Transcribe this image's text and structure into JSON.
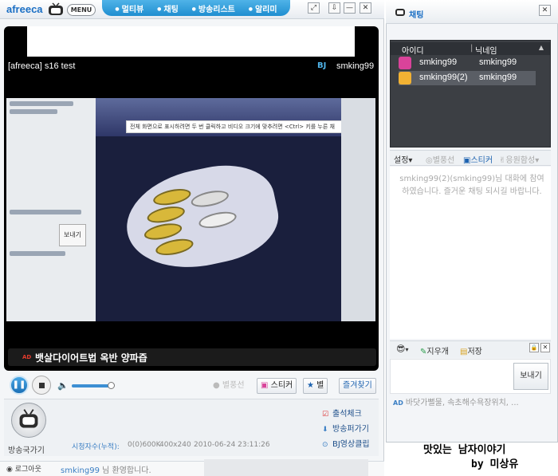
{
  "player": {
    "logo": "afreeca",
    "menu_label": "MENU",
    "tabs": [
      {
        "label": "멀티뷰"
      },
      {
        "label": "채팅"
      },
      {
        "label": "방송리스트"
      },
      {
        "label": "알리미"
      }
    ],
    "window_buttons": [
      "⤢",
      "⇩",
      "—",
      "✕"
    ],
    "broadcast_title": "[afreeca] s16 test",
    "bj_badge": "BJ",
    "bj_name": "smking99",
    "video": {
      "notice_text": "전체 화면으로 표시하려면 두 번 클릭하고 비디오 크기에 맞추려면 <Ctrl> 키를 누른 채",
      "left_panel_send": "보내기"
    },
    "caption_ad": "AD",
    "caption_text": "뱃살다이어트법 옥반 양파즙",
    "controls": {
      "balloon": "별풍선",
      "sticker": "스티커",
      "star": "별",
      "favorite": "즐겨찾기",
      "volume": 0.9
    },
    "info": {
      "bcast_tv_label": "방송국가기",
      "viewers_label": "시청자수(누적):",
      "viewers_value": "0(0)600K",
      "resolution": "400x240",
      "datetime": "2010-06-24 23:11:26",
      "links": [
        "출석체크",
        "방송퍼가기",
        "BJ영상클립"
      ]
    },
    "status": {
      "logout": "로그아웃",
      "welcome_user": "smking99",
      "welcome_text": " 님 환영합니다."
    }
  },
  "chat": {
    "title": "채팅",
    "close": "✕",
    "columns": {
      "id": "아이디",
      "nick": "닉네임"
    },
    "users": [
      {
        "id": "smking99",
        "nick": "smking99",
        "avatar_color": "#d9439a",
        "avatar_badge": "BJ"
      },
      {
        "id": "smking99(2)",
        "nick": "smking99",
        "avatar_color": "#f2b233",
        "avatar_badge": ""
      }
    ],
    "toolbar": {
      "setting": "설정▾",
      "balloon": "별풍선",
      "sticker": "스티커",
      "cheer": "응원함성▾"
    },
    "message": "smking99(2)(smking99)님 대화에 참여하였습니다. 즐거운 채팅 되시길 바랍니다.",
    "tools": {
      "clear": "지우개",
      "save": "저장"
    },
    "send": "보내기",
    "ad_label": "AD",
    "ad_text": "바닷가뻘물, 속초해수욕장위치, ..."
  },
  "overlay": {
    "line1": "맛있는 남자이야기",
    "line2": "by 미상유"
  },
  "colors": {
    "accent": "#1f8ed0",
    "brand": "#1b6fc4",
    "video_bg": "#000000",
    "userlist_bg": "#3c3f44"
  }
}
